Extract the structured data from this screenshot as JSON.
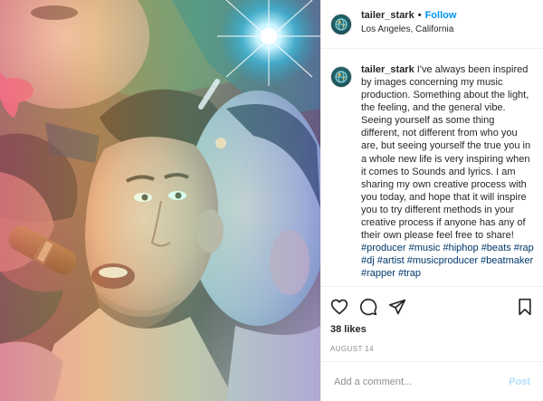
{
  "post": {
    "author": {
      "username": "tailer_stark",
      "location": "Los Angeles, California",
      "separator": "•",
      "follow_label": "Follow",
      "avatar_icon": "globe-icon"
    },
    "caption": {
      "username": "tailer_stark",
      "paragraph_1": "I've always been inspired by images concerning my music production. Something about the light, the feeling, and the general vibe.",
      "paragraph_2": "Seeing yourself as some thing different, not different from who you are, but seeing yourself the true you in a whole new life is very inspiring when it comes to Sounds and lyrics. I am sharing my own creative process with you today, and hope that it will inspire you to try different methods in your creative process if anyone has any of their own please feel free to share!",
      "hashtags": "#producer #music #hiphop #beats #rap #dj #artist #musicproducer #beatmaker #rapper #trap"
    },
    "actions": {
      "like_icon": "heart-icon",
      "comment_icon": "comment-icon",
      "share_icon": "share-icon",
      "save_icon": "bookmark-icon"
    },
    "likes_text": "38 likes",
    "date_text": "AUGUST 14",
    "comment": {
      "placeholder": "Add a comment...",
      "value": "",
      "post_label": "Post"
    }
  },
  "colors": {
    "link_blue": "#0095f6",
    "hashtag_blue": "#00376b",
    "post_disabled": "#b2dffc",
    "muted": "#8e8e8e",
    "border": "#efefef"
  }
}
